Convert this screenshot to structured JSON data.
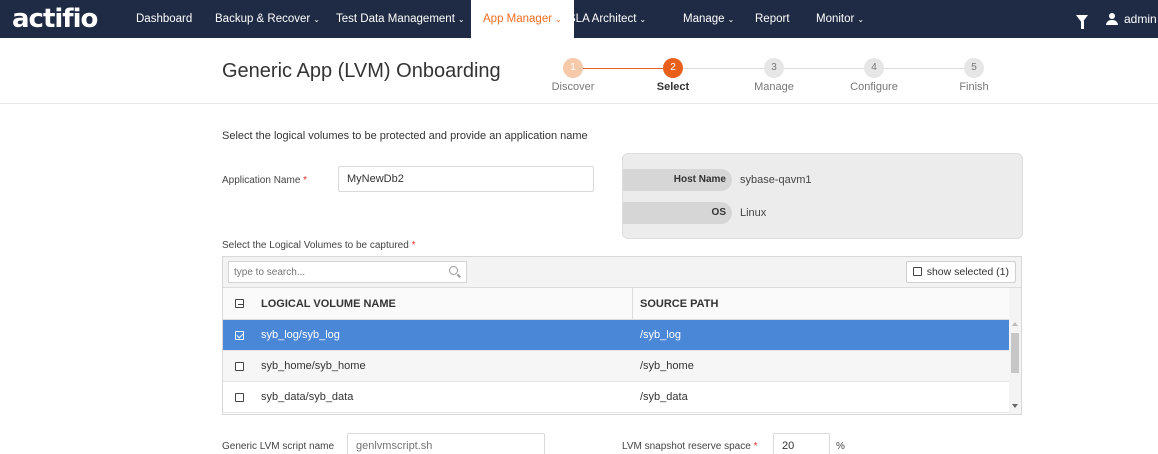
{
  "app": {
    "logo": "actifio"
  },
  "nav": {
    "items": [
      {
        "label": "Dashboard",
        "caret": ""
      },
      {
        "label": "Backup & Recover",
        "caret": "⌄"
      },
      {
        "label": "Test Data Management",
        "caret": "⌄"
      },
      {
        "label": "App Manager",
        "caret": "⌄"
      },
      {
        "label": "SLA Architect",
        "caret": "⌄"
      },
      {
        "label": "Manage",
        "caret": "⌄"
      },
      {
        "label": "Report",
        "caret": ""
      },
      {
        "label": "Monitor",
        "caret": "⌄"
      }
    ],
    "active_item": "App Manager",
    "user": "admin"
  },
  "header": {
    "title": "Generic App (LVM) Onboarding"
  },
  "wizard": {
    "steps": [
      {
        "number": "1",
        "label": "Discover",
        "state": "done"
      },
      {
        "number": "2",
        "label": "Select",
        "state": "current"
      },
      {
        "number": "3",
        "label": "Manage",
        "state": "todo"
      },
      {
        "number": "4",
        "label": "Configure",
        "state": "todo"
      },
      {
        "number": "5",
        "label": "Finish",
        "state": "todo"
      }
    ]
  },
  "form": {
    "instructions": "Select the logical volumes to be protected and provide an application name",
    "app_name_label": "Application Name",
    "required_marker": "*",
    "app_name_value": "MyNewDb2",
    "host": {
      "host_name_label": "Host Name",
      "host_name_value": "sybase-qavm1",
      "os_label": "OS",
      "os_value": "Linux"
    },
    "lv_label": "Select the Logical Volumes to be captured"
  },
  "table": {
    "search_placeholder": "type to search...",
    "show_selected_label": "show selected (1)",
    "columns": [
      "LOGICAL VOLUME NAME",
      "SOURCE PATH"
    ],
    "rows": [
      {
        "name": "syb_log/syb_log",
        "path": "/syb_log",
        "checked": true
      },
      {
        "name": "syb_home/syb_home",
        "path": "/syb_home",
        "checked": false
      },
      {
        "name": "syb_data/syb_data",
        "path": "/syb_data",
        "checked": false
      }
    ]
  },
  "footer": {
    "script_label": "Generic LVM script name",
    "script_placeholder": "genlvmscript.sh",
    "reserve_label": "LVM snapshot reserve space",
    "reserve_value": "20",
    "reserve_unit": "%"
  },
  "colors": {
    "nav_bg": "#1f2a44",
    "accent": "#e8601c",
    "selected_row": "#4a87d6"
  }
}
